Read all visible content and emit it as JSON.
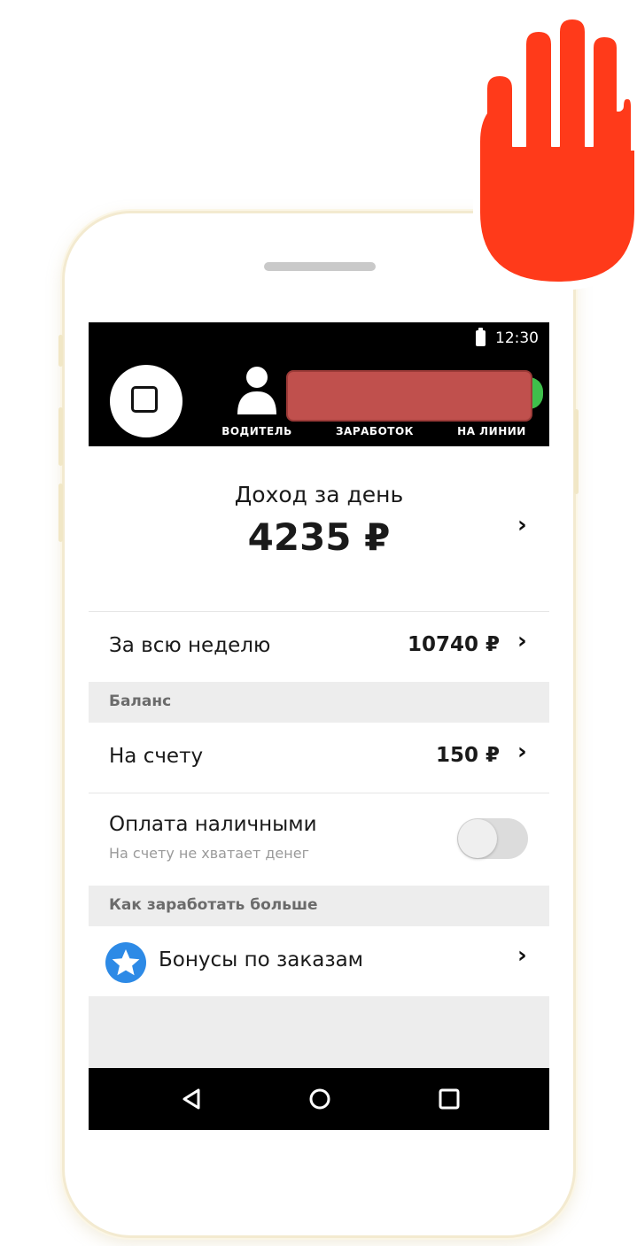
{
  "status_bar": {
    "time": "12:30"
  },
  "header": {
    "tabs": [
      {
        "label": "ВОДИТЕЛЬ"
      },
      {
        "label": "ЗАРАБОТОК"
      },
      {
        "label": "НА ЛИНИИ"
      }
    ]
  },
  "income": {
    "title": "Доход за день",
    "amount": "4235 ₽"
  },
  "week": {
    "label": "За всю неделю",
    "amount": "10740 ₽"
  },
  "balance_section": {
    "title": "Баланс",
    "account_label": "На счету",
    "account_amount": "150 ₽",
    "cash_label": "Оплата наличными",
    "cash_sublabel": "На счету не хватает денег",
    "cash_enabled": false
  },
  "earn_section": {
    "title": "Как заработать больше",
    "bonus_label": "Бонусы по заказам"
  },
  "icons": {
    "chevron": "›",
    "back": "◁",
    "home": "○",
    "recents": "□"
  },
  "colors": {
    "hand": "#ff3a1a",
    "redacted": "#c0504d",
    "online": "#3fbf4b",
    "star_badge": "#2d8ae6"
  }
}
